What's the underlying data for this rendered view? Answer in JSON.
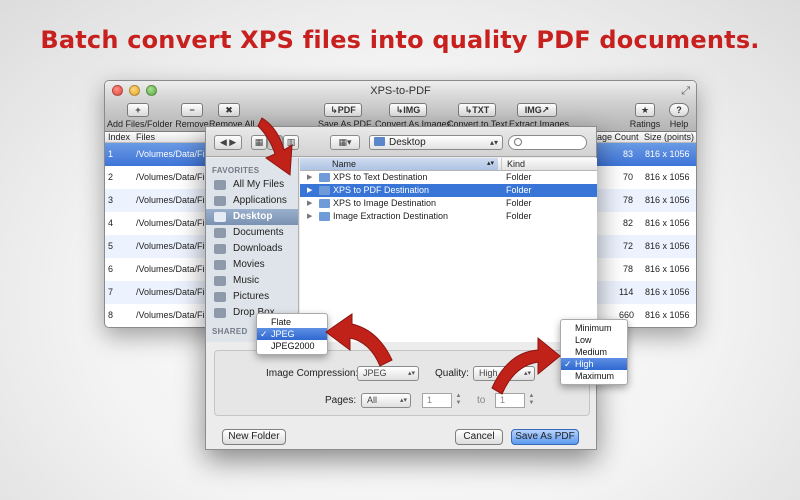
{
  "headline": "Batch convert XPS files into quality PDF documents.",
  "window": {
    "title": "XPS-to-PDF",
    "toolbar": [
      {
        "icon": "plus-icon",
        "glyph": "+",
        "label": "Add Files/Folder"
      },
      {
        "icon": "minus-icon",
        "glyph": "−",
        "label": "Remove"
      },
      {
        "icon": "remove-all-icon",
        "glyph": "✖",
        "label": "Remove All"
      },
      {
        "icon": "pdf-icon",
        "glyph": "↳PDF",
        "label": "Save As PDF"
      },
      {
        "icon": "img-icon",
        "glyph": "↳IMG",
        "label": "Convert As Images"
      },
      {
        "icon": "txt-icon",
        "glyph": "↳TXT",
        "label": "Convert to Text"
      },
      {
        "icon": "extract-img-icon",
        "glyph": "IMG↗",
        "label": "Extract Images"
      },
      {
        "icon": "star-icon",
        "glyph": "★",
        "label": "Ratings"
      },
      {
        "icon": "help-icon",
        "glyph": "?",
        "label": "Help"
      }
    ],
    "columns": {
      "index": "Index",
      "files": "Files",
      "page_count": "Page Count",
      "size": "Size (points)"
    },
    "rows": [
      {
        "index": "1",
        "file": "/Volumes/Data/File",
        "pages": "83",
        "size": "816 x 1056"
      },
      {
        "index": "2",
        "file": "/Volumes/Data/File",
        "pages": "70",
        "size": "816 x 1056"
      },
      {
        "index": "3",
        "file": "/Volumes/Data/File",
        "pages": "78",
        "size": "816 x 1056"
      },
      {
        "index": "4",
        "file": "/Volumes/Data/File",
        "pages": "82",
        "size": "816 x 1056"
      },
      {
        "index": "5",
        "file": "/Volumes/Data/File",
        "pages": "72",
        "size": "816 x 1056"
      },
      {
        "index": "6",
        "file": "/Volumes/Data/File",
        "pages": "78",
        "size": "816 x 1056"
      },
      {
        "index": "7",
        "file": "/Volumes/Data/File",
        "pages": "114",
        "size": "816 x 1056"
      },
      {
        "index": "8",
        "file": "/Volumes/Data/File",
        "pages": "660",
        "size": "816 x 1056"
      }
    ]
  },
  "dialog": {
    "location": "Desktop",
    "sidebar": {
      "favorites_header": "FAVORITES",
      "shared_header": "SHARED",
      "items": [
        "All My Files",
        "Applications",
        "Desktop",
        "Documents",
        "Downloads",
        "Movies",
        "Music",
        "Pictures",
        "Drop Box"
      ]
    },
    "list_headers": {
      "name": "Name",
      "kind": "Kind"
    },
    "files": [
      {
        "name": "XPS to Text Destination",
        "kind": "Folder"
      },
      {
        "name": "XPS to PDF Destination",
        "kind": "Folder"
      },
      {
        "name": "XPS to Image Destination",
        "kind": "Folder"
      },
      {
        "name": "Image Extraction Destination",
        "kind": "Folder"
      }
    ],
    "image_compression_label": "Image Compression:",
    "image_compression_value": "JPEG",
    "quality_label": "Quality:",
    "quality_value": "High",
    "pages_label": "Pages:",
    "pages_value": "All",
    "from_page": "1",
    "to_label": "to",
    "to_page": "1",
    "new_folder": "New Folder",
    "cancel": "Cancel",
    "save": "Save As PDF"
  },
  "compression_menu": {
    "items": [
      "Flate",
      "JPEG",
      "JPEG2000"
    ],
    "checked": "JPEG"
  },
  "quality_menu": {
    "items": [
      "Minimum",
      "Low",
      "Medium",
      "High",
      "Maximum"
    ],
    "checked": "High"
  },
  "colors": {
    "headline": "#c8201e",
    "arrow": "#c0221a",
    "selection": "#3875d7"
  }
}
